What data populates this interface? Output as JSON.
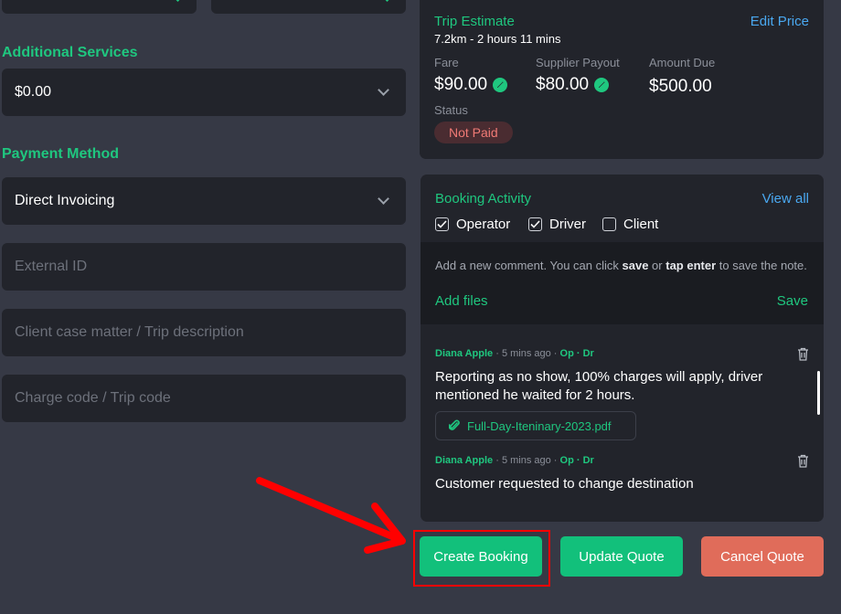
{
  "left": {
    "additional_services": {
      "label": "Additional Services",
      "value": "$0.00"
    },
    "payment_method": {
      "label": "Payment Method",
      "value": "Direct Invoicing"
    },
    "external_id": {
      "placeholder": "External ID"
    },
    "case_matter": {
      "placeholder": "Client case matter / Trip description"
    },
    "charge_code": {
      "placeholder": "Charge code / Trip code"
    }
  },
  "trip_estimate": {
    "title": "Trip Estimate",
    "subtitle": "7.2km - 2 hours 11 mins",
    "edit_label": "Edit Price",
    "fare_label": "Fare",
    "fare_value": "$90.00",
    "payout_label": "Supplier Payout",
    "payout_value": "$80.00",
    "due_label": "Amount Due",
    "due_value": "$500.00",
    "status_label": "Status",
    "status_value": "Not Paid"
  },
  "booking_activity": {
    "title": "Booking Activity",
    "view_all": "View all",
    "filters": [
      {
        "label": "Operator",
        "checked": true
      },
      {
        "label": "Driver",
        "checked": true
      },
      {
        "label": "Client",
        "checked": false
      }
    ],
    "hint_pre": "Add a new comment. You can click ",
    "hint_save": "save",
    "hint_mid": " or ",
    "hint_enter": "tap enter",
    "hint_post": " to save the note.",
    "add_files": "Add files",
    "save": "Save",
    "comments": [
      {
        "author": "Diana Apple",
        "time": " · 5 mins ago · ",
        "tags": "Op · Dr",
        "text": "Reporting as no show, 100% charges will apply, driver mentioned he waited for 2 hours.",
        "attachment": "Full-Day-Iteninary-2023.pdf"
      },
      {
        "author": "Diana Apple",
        "time": " · 5 mins ago · ",
        "tags": "Op · Dr",
        "text": "Customer requested to change destination"
      }
    ]
  },
  "actions": {
    "create": "Create Booking",
    "update": "Update Quote",
    "cancel": "Cancel Quote"
  },
  "colors": {
    "accent": "#1fc77f",
    "link": "#4aa8f0",
    "danger": "#e06c5a",
    "annotation": "#ff0000"
  }
}
